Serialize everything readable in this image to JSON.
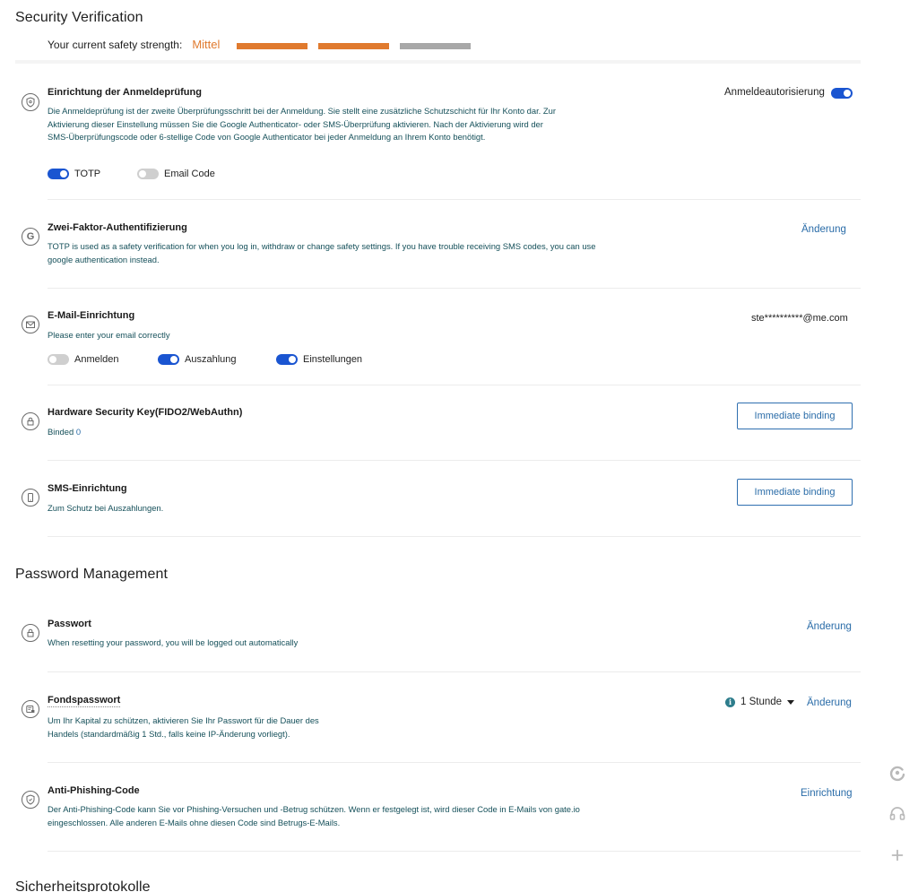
{
  "security": {
    "title": "Security Verification",
    "strength_label": "Your current safety strength:",
    "strength_level": "Mittel",
    "strength_filled": 2,
    "strength_total": 3,
    "colors": {
      "filled": "#e07a2e",
      "empty": "#a8a8a8"
    }
  },
  "login_check": {
    "title": "Einrichtung der Anmeldeprüfung",
    "description": "Die Anmeldeprüfung ist der zweite Überprüfungsschritt bei der Anmeldung. Sie stellt eine zusätzliche Schutzschicht für Ihr Konto dar. Zur Aktivierung dieser Einstellung müssen Sie die Google Authenticator- oder SMS-Überprüfung aktivieren. Nach der Aktivierung wird der SMS-Überprüfungscode oder 6-stellige Code von Google Authenticator bei jeder Anmeldung an Ihrem Konto benötigt.",
    "auth_label": "Anmeldeautorisierung",
    "auth_on": true,
    "options": [
      {
        "label": "TOTP",
        "on": true
      },
      {
        "label": "Email Code",
        "on": false
      }
    ]
  },
  "two_factor": {
    "title": "Zwei-Faktor-Authentifizierung",
    "description": "TOTP is used as a safety verification for when you log in, withdraw or change safety settings. If you have trouble receiving SMS codes, you can use google authentication instead.",
    "action": "Änderung"
  },
  "email": {
    "title": "E-Mail-Einrichtung",
    "description": "Please enter your email correctly",
    "address": "ste**********@me.com",
    "options": [
      {
        "label": "Anmelden",
        "on": false
      },
      {
        "label": "Auszahlung",
        "on": true
      },
      {
        "label": "Einstellungen",
        "on": true
      }
    ]
  },
  "hardware_key": {
    "title": "Hardware Security Key(FIDO2/WebAuthn)",
    "bound_label": "Binded",
    "bound_count": "0",
    "button": "Immediate binding"
  },
  "sms": {
    "title": "SMS-Einrichtung",
    "description": "Zum Schutz bei Auszahlungen.",
    "button": "Immediate binding"
  },
  "password_mgmt": {
    "title": "Password Management"
  },
  "password": {
    "title": "Passwort",
    "description": "When resetting your password, you will be logged out automatically",
    "action": "Änderung"
  },
  "fund_password": {
    "title": "Fondspasswort",
    "description_line1": "Um Ihr Kapital zu schützen, aktivieren Sie Ihr Passwort für die Dauer des",
    "description_line2": "Handels (standardmäßig 1 Std., falls keine IP-Änderung vorliegt).",
    "duration": "1 Stunde",
    "action": "Änderung"
  },
  "anti_phishing": {
    "title": "Anti-Phishing-Code",
    "description": "Der Anti-Phishing-Code kann Sie vor Phishing-Versuchen und -Betrug schützen. Wenn er festgelegt ist, wird dieser Code in E-Mails von gate.io eingeschlossen. Alle anderen E-Mails ohne diesen Code sind Betrugs-E-Mails.",
    "action": "Einrichtung"
  },
  "protocols": {
    "title": "Sicherheitsprotokolle"
  },
  "floating": [
    {
      "icon": "refresh-icon"
    },
    {
      "icon": "headset-icon"
    },
    {
      "icon": "plus-icon"
    }
  ]
}
